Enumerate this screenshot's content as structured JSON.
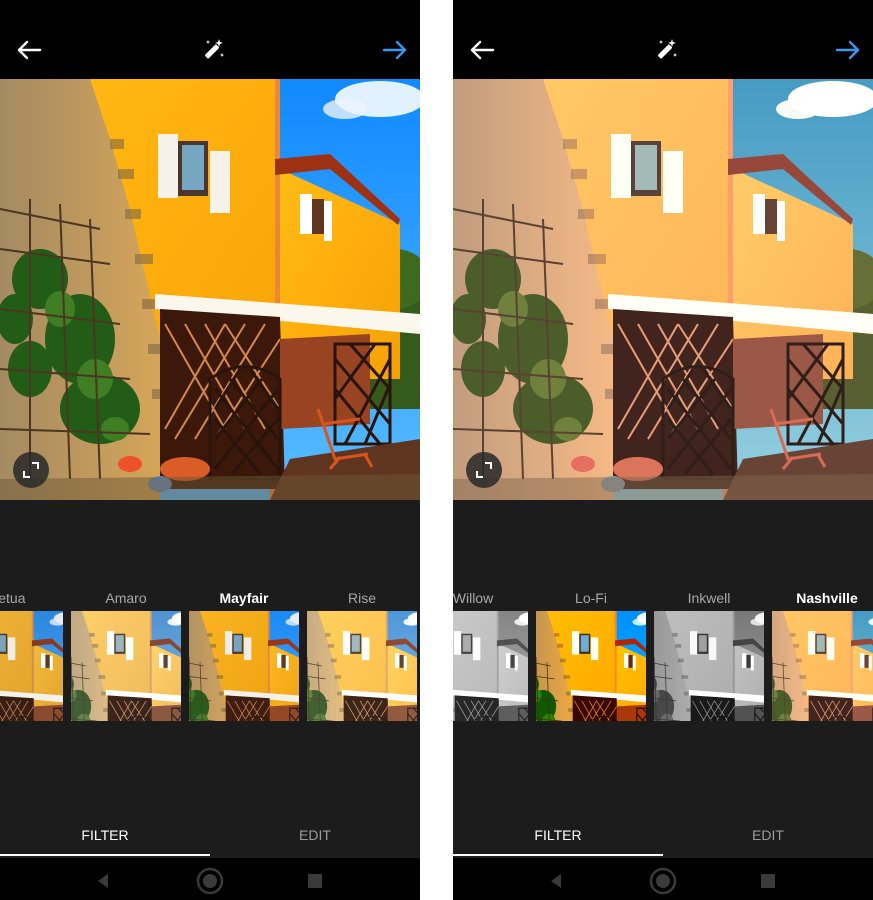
{
  "screens": [
    {
      "filters": [
        {
          "label": "petua",
          "selected": false,
          "tint": "normal"
        },
        {
          "label": "Amaro",
          "selected": false,
          "tint": "amaro"
        },
        {
          "label": "Mayfair",
          "selected": true,
          "tint": "mayfair"
        },
        {
          "label": "Rise",
          "selected": false,
          "tint": "rise"
        }
      ],
      "photo_tint": "mayfair",
      "tabs": {
        "filter": "FILTER",
        "edit": "EDIT"
      }
    },
    {
      "filters": [
        {
          "label": "Willow",
          "selected": false,
          "tint": "willow"
        },
        {
          "label": "Lo-Fi",
          "selected": false,
          "tint": "lofi"
        },
        {
          "label": "Inkwell",
          "selected": false,
          "tint": "inkwell"
        },
        {
          "label": "Nashville",
          "selected": true,
          "tint": "nashville"
        }
      ],
      "photo_tint": "nashville",
      "tabs": {
        "filter": "FILTER",
        "edit": "EDIT"
      }
    }
  ],
  "icons": {
    "back": "back-arrow-icon",
    "magic": "magic-wand-icon",
    "next": "next-arrow-icon",
    "expand": "expand-icon"
  },
  "colors": {
    "accent": "#3897f0",
    "topbar": "#000000",
    "panel": "#1c1c1c",
    "selected_text": "#ffffff",
    "unselected_text": "#a8a8a8"
  }
}
